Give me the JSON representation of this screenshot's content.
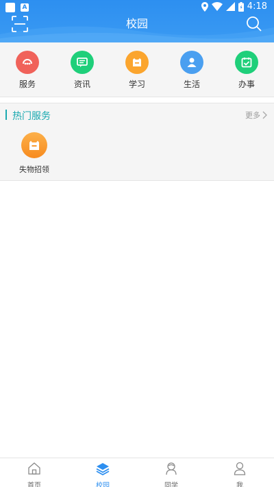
{
  "status_bar": {
    "time": "4:18",
    "notification_icon": "app-icon",
    "keyboard_icon": "a-icon"
  },
  "header": {
    "title": "校园",
    "left_icon": "scan-icon",
    "right_icon": "search-icon",
    "color": "#2d8ff0"
  },
  "categories": [
    {
      "label": "服务",
      "icon": "service-icon",
      "color": "#f0625a"
    },
    {
      "label": "资讯",
      "icon": "news-icon",
      "color": "#1fcf7a"
    },
    {
      "label": "学习",
      "icon": "study-icon",
      "color": "#fba52e"
    },
    {
      "label": "生活",
      "icon": "person-icon",
      "color": "#4a9ff0"
    },
    {
      "label": "办事",
      "icon": "calendar-check-icon",
      "color": "#1fcf7a"
    }
  ],
  "hot_services": {
    "title": "热门服务",
    "more": "更多",
    "items": [
      {
        "label": "失物招领",
        "icon": "box-icon",
        "color": "#f99a30"
      }
    ]
  },
  "bottom_nav": [
    {
      "label": "首页",
      "icon": "home-icon",
      "active": false
    },
    {
      "label": "校园",
      "icon": "layers-icon",
      "active": true
    },
    {
      "label": "同学",
      "icon": "classmates-icon",
      "active": false
    },
    {
      "label": "我",
      "icon": "user-icon",
      "active": false
    }
  ],
  "colors": {
    "accent": "#2d8ff0",
    "hot_title": "#1aa9b0"
  }
}
